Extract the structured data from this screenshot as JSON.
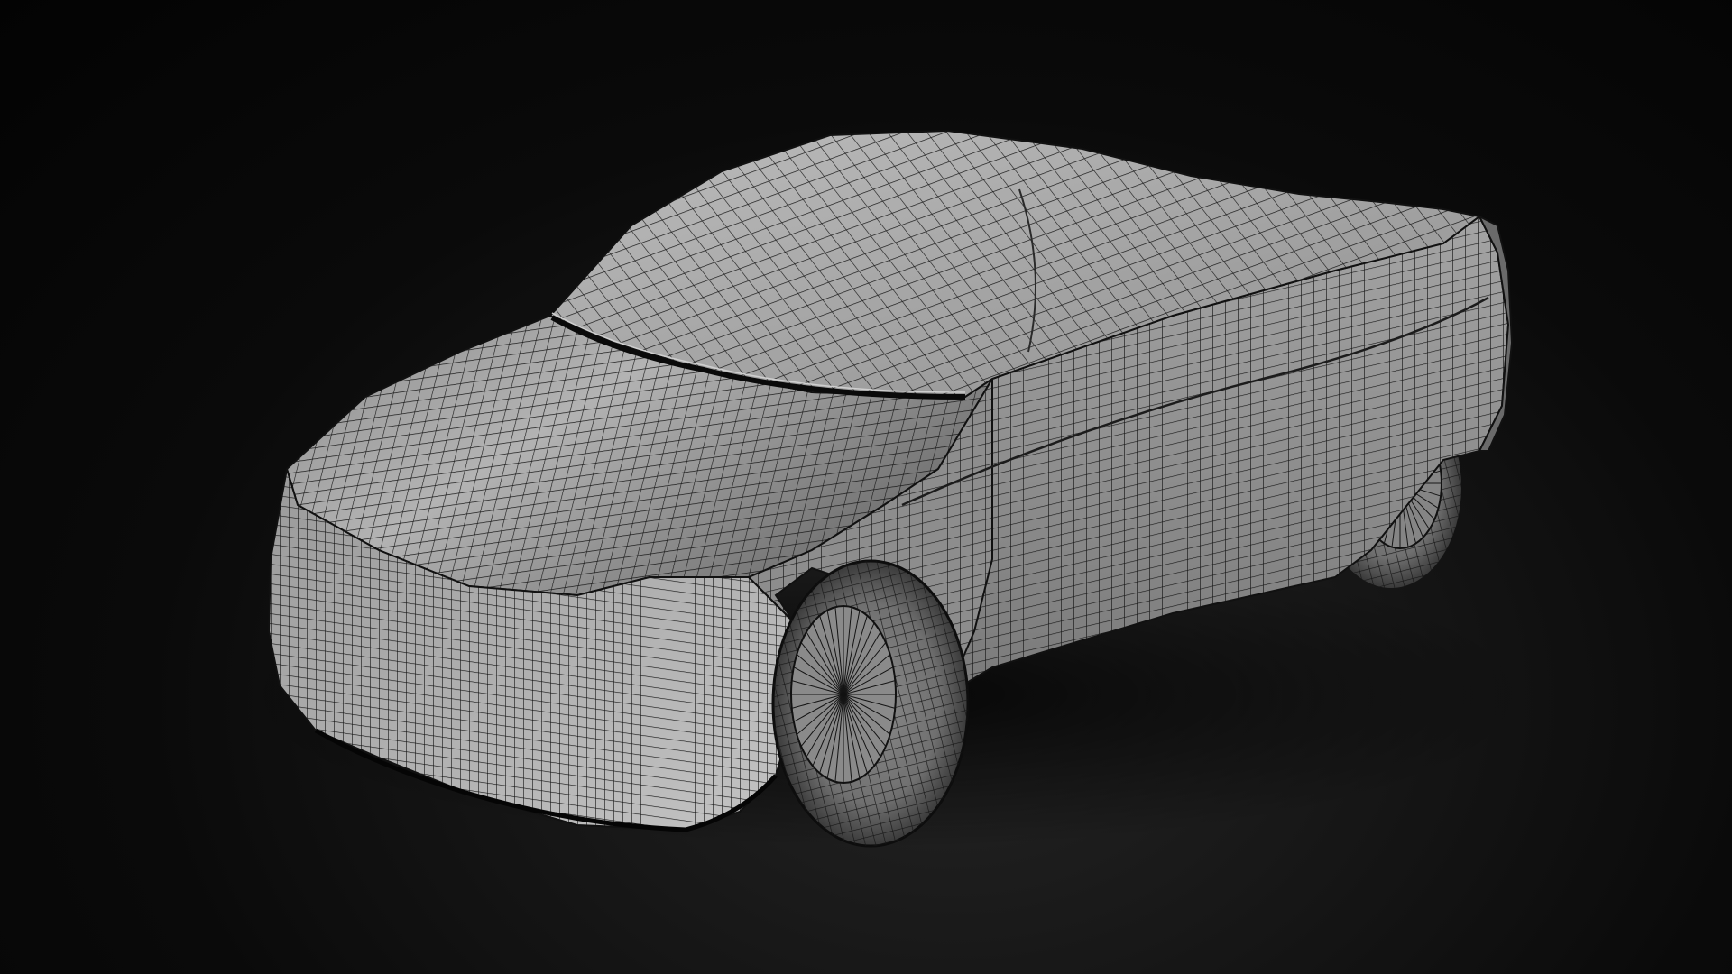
{
  "scene": {
    "subject": "car-wireframe-render",
    "background_color": "#050505",
    "floor_glow_color": "#242424",
    "surface_color": "#a9a9a9",
    "wire_color": "#161616",
    "tire_color": "#3a3a3a"
  }
}
